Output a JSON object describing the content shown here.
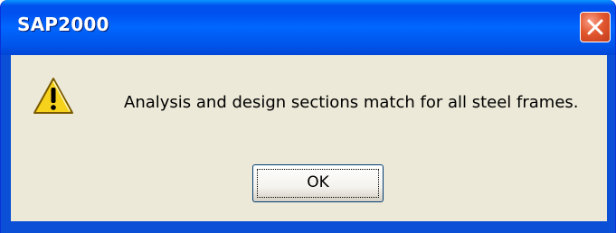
{
  "window": {
    "title": "SAP2000",
    "close_icon": "close-icon"
  },
  "dialog": {
    "icon": "warning-icon",
    "message": "Analysis and design sections match for all steel frames.",
    "ok_label": "OK"
  },
  "colors": {
    "titlebar": "#0055ea",
    "client_background": "#ece9d8",
    "close_button": "#e2582f",
    "warning_yellow": "#f7d21c"
  }
}
